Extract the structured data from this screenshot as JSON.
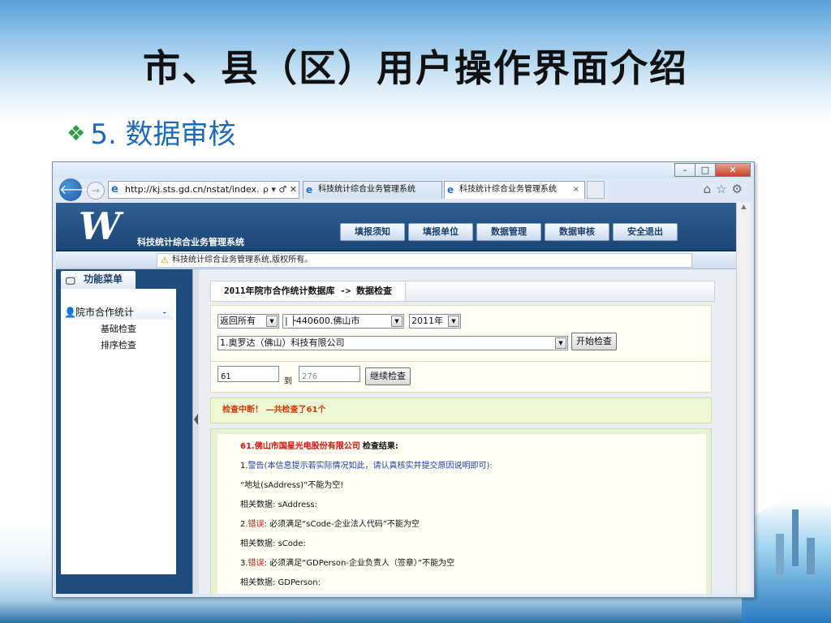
{
  "slide": {
    "title": "市、县（区）用户操作界面介绍",
    "subtitle_bullet": "❖",
    "subtitle": "5. 数据审核"
  },
  "browser": {
    "url": "http://kj.sts.gd.cn/nstat/index.",
    "url_tools": "ρ ▾ ♂ ✕",
    "tabs": [
      {
        "label": "科技统计综合业务管理系统"
      },
      {
        "label": "科技统计综合业务管理系统"
      }
    ],
    "window_buttons": {
      "minimize": "–",
      "maximize": "□",
      "close": "✕"
    }
  },
  "app": {
    "logo": "W",
    "system_name": "科技统计综合业务管理系统",
    "nav": [
      "填报须知",
      "填报单位",
      "数据管理",
      "数据审核",
      "安全退出"
    ],
    "notice": "科技统计综合业务管理系统,版权所有。",
    "sidebar": {
      "menu_title": "功能菜单",
      "group": "院市合作统计",
      "group_toggle": "-",
      "items": [
        "基础检查",
        "排序检查"
      ]
    },
    "main": {
      "breadcrumb": "2011年院市合作统计数据库 -> 数据检查",
      "filters": {
        "scope": "返回所有",
        "region": "|  ├440600.佛山市",
        "year": "2011年",
        "company": "1.奥罗达（佛山）科技有限公司",
        "start_button": "开始检查"
      },
      "range": {
        "from": "61",
        "to_label": "到",
        "to": "276",
        "continue_button": "继续检查"
      },
      "alert": "检查中断！ —共检查了61个",
      "result": {
        "company": "61.佛山市国星光电股份有限公司",
        "heading": "检查结果:",
        "lines": [
          {
            "prefix": "1.",
            "tag": "警告",
            "text": "(本信息提示若实际情况如此，请认真核实并提交原因说明即可):"
          },
          {
            "prefix": "",
            "tag": "",
            "text": "“地址(sAddress)”不能为空!"
          },
          {
            "prefix": "",
            "tag": "",
            "text": "相关数据: sAddress:"
          },
          {
            "prefix": "2.",
            "tag": "错误",
            "text": ": 必须满足“sCode-企业法人代码”不能为空"
          },
          {
            "prefix": "",
            "tag": "",
            "text": "相关数据: sCode:"
          },
          {
            "prefix": "3.",
            "tag": "错误",
            "text": ": 必须满足“GDPerson-企业负责人（签章）”不能为空"
          },
          {
            "prefix": "",
            "tag": "",
            "text": "相关数据: GDPerson:"
          }
        ]
      }
    }
  }
}
